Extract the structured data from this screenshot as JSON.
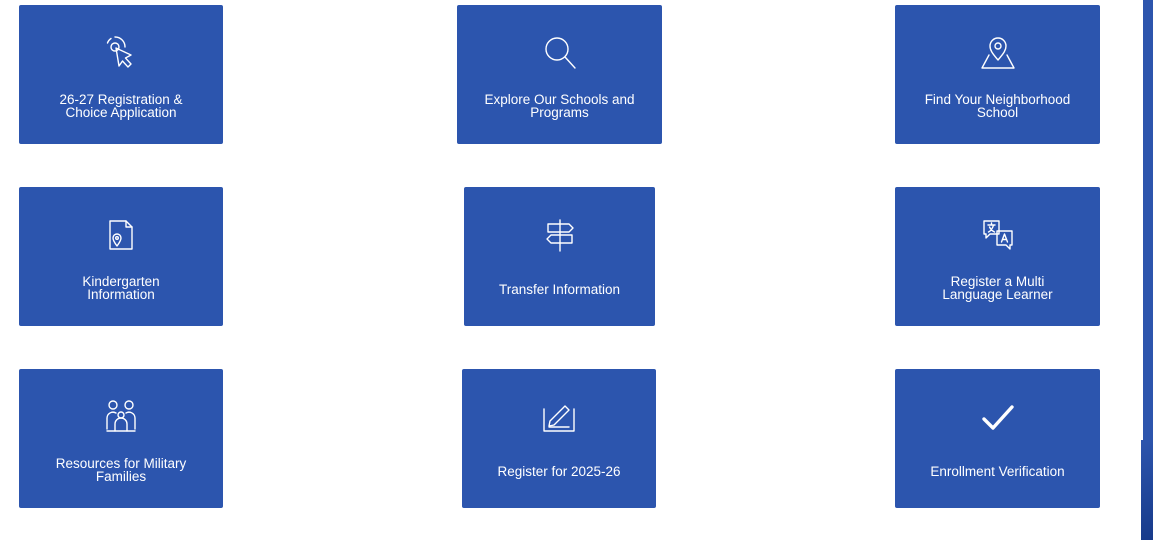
{
  "tiles": [
    {
      "label": "26-27 Registration &\nChoice Application",
      "icon": "cursor-click-icon"
    },
    {
      "label": "Explore Our Schools and\nPrograms",
      "icon": "search-icon"
    },
    {
      "label": "Find Your Neighborhood\nSchool",
      "icon": "map-pin-icon"
    },
    {
      "label": "Kindergarten\nInformation",
      "icon": "document-location-icon"
    },
    {
      "label": "Transfer Information",
      "icon": "signpost-icon"
    },
    {
      "label": "Register a Multi\nLanguage Learner",
      "icon": "translate-icon"
    },
    {
      "label": "Resources for Military\nFamilies",
      "icon": "family-icon"
    },
    {
      "label": "Register for 2025-26",
      "icon": "signature-icon"
    },
    {
      "label": "Enrollment Verification",
      "icon": "checkmark-icon"
    }
  ],
  "colors": {
    "tile": "#2c55ae",
    "text": "#ffffff"
  }
}
